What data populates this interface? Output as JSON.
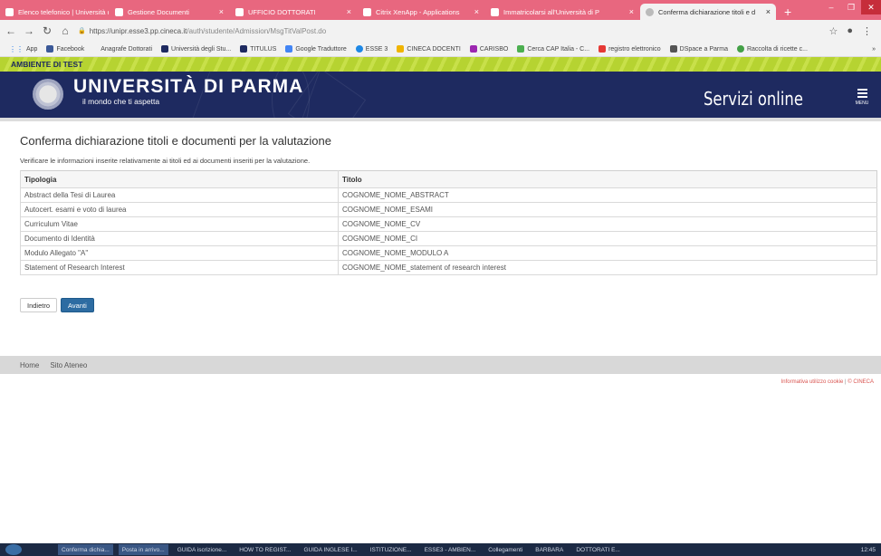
{
  "browser": {
    "tabs": [
      {
        "label": "Elenco telefonico | Università di"
      },
      {
        "label": "Gestione Documenti"
      },
      {
        "label": "UFFICIO DOTTORATI"
      },
      {
        "label": "Citrix XenApp - Applications"
      },
      {
        "label": "Immatricolarsi all'Università di P"
      },
      {
        "label": "Conferma dichiarazione titoli e d"
      }
    ],
    "new_tab": "+",
    "url_secure": "https://unipr.esse3.pp.cineca.it",
    "url_path": "/auth/studente/Admission/MsgTitValPost.do",
    "bookmarks": [
      {
        "label": "App",
        "color": "#7b7b7b"
      },
      {
        "label": "Facebook",
        "color": "#3b5998"
      },
      {
        "label": "Anagrafe Dottorati",
        "color": "#ffffff"
      },
      {
        "label": "Università degli Stu...",
        "color": "#1e2a60"
      },
      {
        "label": "TITULUS",
        "color": "#1e2a60"
      },
      {
        "label": "Google Traduttore",
        "color": "#4285f4"
      },
      {
        "label": "ESSE 3",
        "color": "#1e88e5"
      },
      {
        "label": "CINECA DOCENTI",
        "color": "#f0b400"
      },
      {
        "label": "CARISBO",
        "color": "#9c27b0"
      },
      {
        "label": "Cerca CAP Italia - C...",
        "color": "#4caf50"
      },
      {
        "label": "registro elettronico",
        "color": "#e53935"
      },
      {
        "label": "DSpace a Parma",
        "color": "#555555"
      },
      {
        "label": "Raccolta di ricette c...",
        "color": "#43a047"
      }
    ]
  },
  "banner": {
    "test_env": "AMBIENTE DI TEST"
  },
  "header": {
    "university": "UNIVERSITÀ DI PARMA",
    "tagline": "il mondo che ti aspetta",
    "services": "Servizi online",
    "menu": "MENU"
  },
  "page": {
    "title": "Conferma dichiarazione titoli e documenti per la valutazione",
    "intro": "Verificare le informazioni inserite relativamente ai titoli ed ai documenti inseriti per la valutazione."
  },
  "table": {
    "headers": [
      "Tipologia",
      "Titolo"
    ],
    "rows": [
      [
        "Abstract della Tesi di Laurea",
        "COGNOME_NOME_ABSTRACT"
      ],
      [
        "Autocert. esami e voto di laurea",
        "COGNOME_NOME_ESAMI"
      ],
      [
        "Curriculum Vitae",
        "COGNOME_NOME_CV"
      ],
      [
        "Documento di Identità",
        "COGNOME_NOME_CI"
      ],
      [
        "Modulo Allegato \"A\"",
        "COGNOME_NOME_MODULO A"
      ],
      [
        "Statement of Research Interest",
        "COGNOME_NOME_statement of research interest"
      ]
    ]
  },
  "buttons": {
    "back": "Indietro",
    "next": "Avanti"
  },
  "footer": {
    "home": "Home",
    "site": "Sito Ateneo",
    "cookie": "Informativa utilizzo cookie",
    "separator": " | ",
    "copyright": "© CINECA"
  },
  "taskbar": {
    "items": [
      "Conferma dichia...",
      "Posta in arrivo...",
      "GUIDA iscrizione...",
      "HOW TO REGIST...",
      "GUIDA INGLESE I...",
      "ISTITUZIONE...",
      "ESSE3 - AMBIEN...",
      "Collegamenti",
      "BARBARA",
      "DOTTORATI E..."
    ],
    "clock": "12:45"
  }
}
